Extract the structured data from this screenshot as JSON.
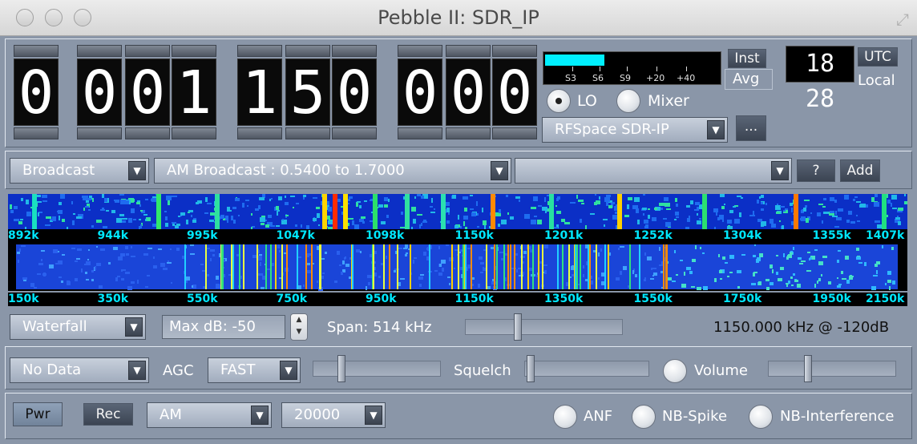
{
  "window": {
    "title": "Pebble II: SDR_IP"
  },
  "frequency": {
    "digits": [
      "0",
      "0",
      "0",
      "1",
      "1",
      "5",
      "0",
      "0",
      "0",
      "0"
    ]
  },
  "smeter": {
    "labels": [
      "S3",
      "S6",
      "S9",
      "+20",
      "+40"
    ],
    "level_fraction": 0.34
  },
  "meter_mode": {
    "inst": "Inst",
    "avg": "Avg"
  },
  "clock": {
    "time": "18 28",
    "utc": "UTC",
    "local": "Local"
  },
  "source": {
    "lo": "LO",
    "mixer": "Mixer",
    "device": "RFSpace SDR-IP",
    "more": "..."
  },
  "bands": {
    "category": "Broadcast",
    "band": "AM Broadcast : 0.5400 to 1.7000",
    "station": "",
    "help": "?",
    "add": "Add"
  },
  "spectrum": {
    "top_axis": [
      "892k",
      "944k",
      "995k",
      "1047k",
      "1098k",
      "1150k",
      "1201k",
      "1252k",
      "1304k",
      "1355k",
      "1407k"
    ],
    "bottom_axis": [
      "150k",
      "350k",
      "550k",
      "750k",
      "950k",
      "1150k",
      "1350k",
      "1550k",
      "1750k",
      "1950k",
      "2150k"
    ]
  },
  "display": {
    "mode": "Waterfall",
    "maxdb": "Max dB: -50",
    "span": "Span: 514 kHz",
    "readout": "1150.000 kHz @ -120dB"
  },
  "audio": {
    "nodata": "No Data",
    "agc_label": "AGC",
    "agc": "FAST",
    "squelch": "Squelch",
    "volume": "Volume"
  },
  "bottom": {
    "pwr": "Pwr",
    "rec": "Rec",
    "mode": "AM",
    "bandwidth": "20000",
    "anf": "ANF",
    "nb_spike": "NB-Spike",
    "nb_interf": "NB-Interference"
  }
}
